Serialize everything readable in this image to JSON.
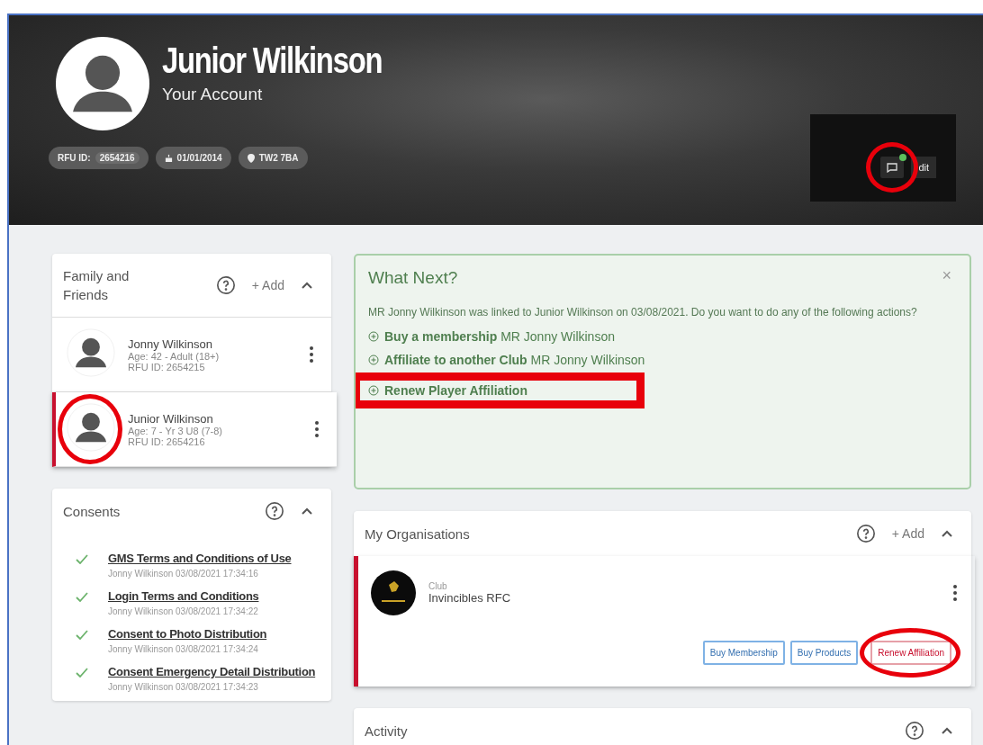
{
  "profile": {
    "name": "Junior Wilkinson",
    "subtitle": "Your Account",
    "chips": [
      {
        "kind": "id",
        "label": "RFU ID:",
        "value": "2654216"
      },
      {
        "kind": "birthday",
        "value": "01/01/2014"
      },
      {
        "kind": "location",
        "value": "TW2 7BA"
      }
    ],
    "messages": {
      "unread": true,
      "circled": true
    },
    "edit_label": "dit"
  },
  "family": {
    "title": "Family and Friends",
    "add": "+ Add",
    "expanded": true,
    "members": [
      {
        "name": "Jonny Wilkinson",
        "age": "Age: 42 - Adult (18+)",
        "rfu_id": "RFU ID: 2654215",
        "selected": false,
        "circled": false
      },
      {
        "name": "Junior Wilkinson",
        "age": "Age: 7 - Yr 3 U8 (7-8)",
        "rfu_id": "RFU ID: 2654216",
        "selected": true,
        "circled": true
      }
    ]
  },
  "consents": {
    "title": "Consents",
    "expanded": true,
    "items": [
      {
        "title": "GMS Terms and Conditions of Use",
        "meta": "Jonny Wilkinson 03/08/2021 17:34:16",
        "checked": true
      },
      {
        "title": "Login Terms and Conditions",
        "meta": "Jonny Wilkinson 03/08/2021 17:34:22",
        "checked": true
      },
      {
        "title": "Consent to Photo Distribution",
        "meta": "Jonny Wilkinson 03/08/2021 17:34:24",
        "checked": true
      },
      {
        "title": "Consent Emergency Detail Distribution",
        "meta": "Jonny Wilkinson 03/08/2021 17:34:23",
        "checked": true
      }
    ]
  },
  "what_next": {
    "title": "What Next?",
    "close": "×",
    "message": "MR Jonny Wilkinson was linked to Junior Wilkinson on 03/08/2021. Do you want to do any of the following actions?",
    "actions": [
      {
        "text": "**Buy a membership** MR Jonny Wilkinson",
        "boxed": false
      },
      {
        "text": "**Affiliate to another Club** MR Jonny Wilkinson",
        "boxed": false
      },
      {
        "text": "**Renew Player Affiliation**",
        "boxed": true
      }
    ]
  },
  "organisations": {
    "title": "My Organisations",
    "add": "+ Add",
    "expanded": true,
    "items": [
      {
        "type": "Club",
        "name": "Invincibles RFC",
        "selected": true,
        "buttons": [
          {
            "label": "Buy Membership",
            "kind": "primary",
            "circled": false
          },
          {
            "label": "Buy Products",
            "kind": "primary",
            "circled": false
          },
          {
            "label": "Renew Affiliation",
            "kind": "danger",
            "circled": true
          }
        ]
      }
    ]
  },
  "activity": {
    "title": "Activity",
    "expanded": true
  }
}
